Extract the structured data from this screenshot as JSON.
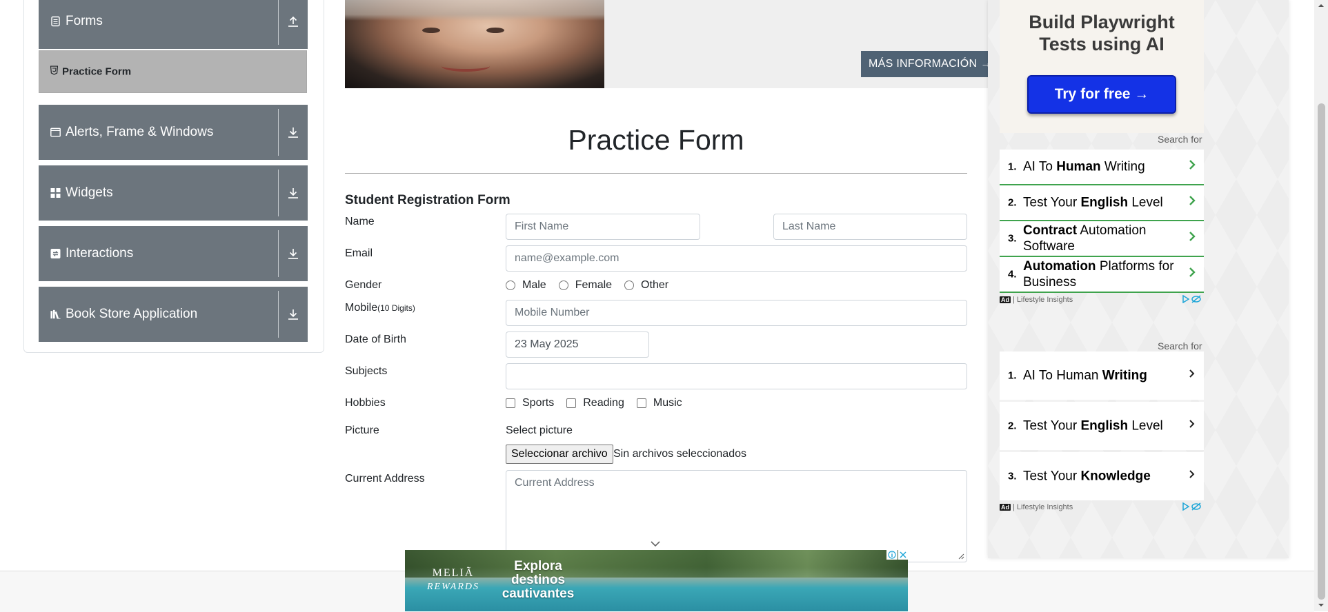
{
  "sidebar": {
    "groups": [
      {
        "label": "Forms",
        "icon": "document-icon",
        "toggle": "collapse-up-icon"
      },
      {
        "label": "Alerts, Frame & Windows",
        "icon": "window-icon",
        "toggle": "expand-down-icon"
      },
      {
        "label": "Widgets",
        "icon": "widgets-icon",
        "toggle": "expand-down-icon"
      },
      {
        "label": "Interactions",
        "icon": "interactions-icon",
        "toggle": "expand-down-icon"
      },
      {
        "label": "Book Store Application",
        "icon": "books-icon",
        "toggle": "expand-down-icon"
      }
    ],
    "active_item": {
      "label": "Practice Form",
      "icon": "html5-icon"
    }
  },
  "banner": {
    "more_info_label": "MÁS INFORMACIÓN →"
  },
  "form": {
    "title": "Practice Form",
    "subtitle": "Student Registration Form",
    "labels": {
      "name": "Name",
      "email": "Email",
      "gender": "Gender",
      "mobile": "Mobile",
      "mobile_hint": "(10 Digits)",
      "dob": "Date of Birth",
      "subjects": "Subjects",
      "hobbies": "Hobbies",
      "picture": "Picture",
      "address": "Current Address"
    },
    "placeholders": {
      "first_name": "First Name",
      "last_name": "Last Name",
      "email": "name@example.com",
      "mobile": "Mobile Number",
      "address": "Current Address"
    },
    "dob_value": "23 May 2025",
    "subjects_value": "",
    "gender_options": [
      "Male",
      "Female",
      "Other"
    ],
    "hobby_options": [
      "Sports",
      "Reading",
      "Music"
    ],
    "picture_caption": "Select picture",
    "file_button": "Seleccionar archivo",
    "file_status": "Sin archivos seleccionados"
  },
  "ads": {
    "playwright": {
      "title_line1": "Build Playwright",
      "title_line2": "Tests using AI",
      "button": "Try for free →"
    },
    "search_for": "Search for",
    "list1": [
      {
        "num": "1.",
        "pre": "AI To ",
        "bold": "Human",
        "post": " Writing"
      },
      {
        "num": "2.",
        "pre": "Test Your ",
        "bold": "English",
        "post": " Level"
      },
      {
        "num": "3.",
        "pre": "",
        "bold": "Contract",
        "post": " Automation Software"
      },
      {
        "num": "4.",
        "pre": "",
        "bold": "Automation",
        "post": " Platforms for Business"
      }
    ],
    "list2": [
      {
        "num": "1.",
        "pre": "AI To Human ",
        "bold": "Writing",
        "post": ""
      },
      {
        "num": "2.",
        "pre": "Test Your ",
        "bold": "English",
        "post": " Level"
      },
      {
        "num": "3.",
        "pre": "Test Your ",
        "bold": "Knowledge",
        "post": ""
      }
    ],
    "ad_badge": "Ad",
    "sponsor": "| Lifestyle Insights",
    "accent_green": "#3fa34d",
    "button_blue": "#1432e6"
  },
  "bottom_ad": {
    "brand_line1": "MELIÃ",
    "brand_line2": "REWARDS",
    "headline": "Explora destinos cautivantes"
  },
  "colors": {
    "sidebar_group": "#6c757d",
    "sidebar_active": "#b3b3b3",
    "banner_button": "#4f6274"
  }
}
